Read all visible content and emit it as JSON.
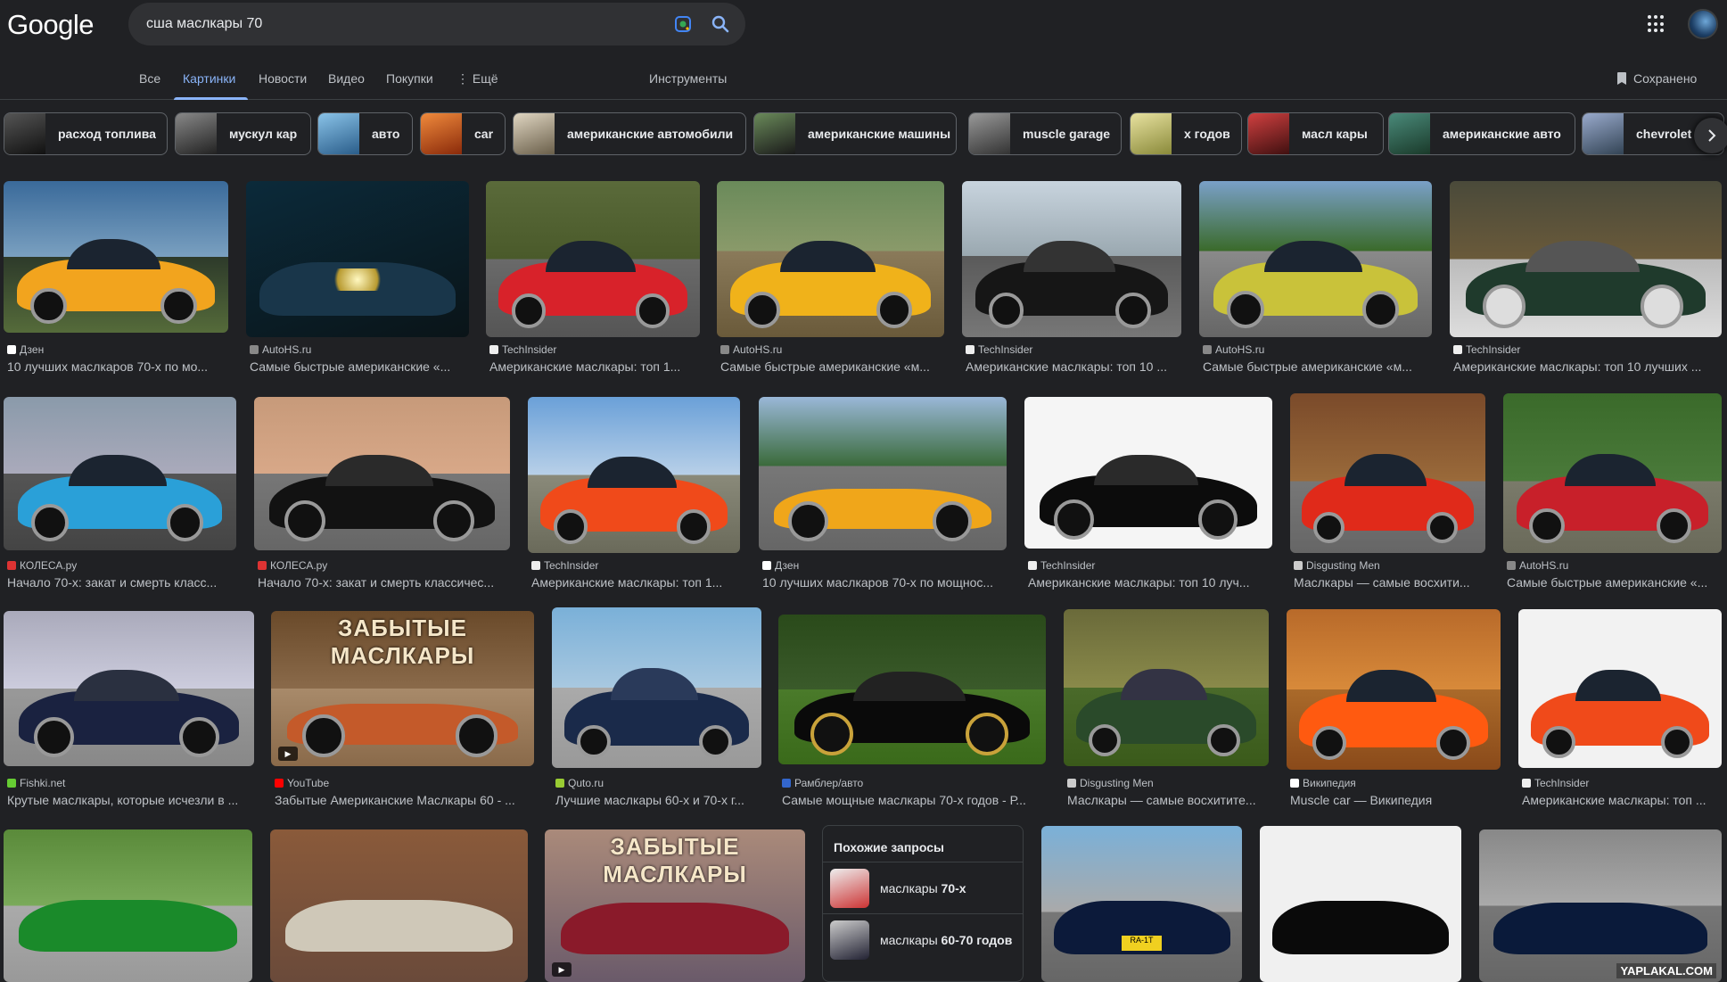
{
  "logo": "Google",
  "search": {
    "value": "сша маслкары 70"
  },
  "tabs": [
    {
      "label": "Все"
    },
    {
      "label": "Картинки"
    },
    {
      "label": "Новости"
    },
    {
      "label": "Видео"
    },
    {
      "label": "Покупки"
    },
    {
      "label": "⋮ Ещё"
    }
  ],
  "tools_label": "Инструменты",
  "saved_label": "Сохранено",
  "chips": [
    "расход топлива",
    "мускул кар",
    "авто",
    "car",
    "американские автомобили",
    "американские машины",
    "muscle garage",
    "х годов",
    "масл кары",
    "американские авто",
    "chevrolet"
  ],
  "rows": [
    [
      {
        "source": "Дзен",
        "caption": "10 лучших маслкаров 70-х по мо..."
      },
      {
        "source": "AutoHS.ru",
        "caption": "Самые быстрые американские «..."
      },
      {
        "source": "TechInsider",
        "caption": "Американские маслкары: топ 1..."
      },
      {
        "source": "AutoHS.ru",
        "caption": "Самые быстрые американские «м..."
      },
      {
        "source": "TechInsider",
        "caption": "Американские маслкары: топ 10 ..."
      },
      {
        "source": "AutoHS.ru",
        "caption": "Самые быстрые американские «м..."
      },
      {
        "source": "TechInsider",
        "caption": "Американские маслкары: топ 10 лучших ..."
      }
    ],
    [
      {
        "source": "КОЛЕСА.ру",
        "caption": "Начало 70-х: закат и смерть класс..."
      },
      {
        "source": "КОЛЕСА.ру",
        "caption": "Начало 70-х: закат и смерть классичес..."
      },
      {
        "source": "TechInsider",
        "caption": "Американские маслкары: топ 1..."
      },
      {
        "source": "Дзен",
        "caption": "10 лучших маслкаров 70-х по мощнос..."
      },
      {
        "source": "TechInsider",
        "caption": "Американские маслкары: топ 10 луч..."
      },
      {
        "source": "Disgusting Men",
        "caption": "Маслкары — самые восхити..."
      },
      {
        "source": "AutoHS.ru",
        "caption": "Самые быстрые американские «..."
      }
    ],
    [
      {
        "source": "Fishki.net",
        "caption": "Крутые маслкары, которые исчезли в ..."
      },
      {
        "source": "YouTube",
        "caption": "Забытые Американские Маслкары 60 - ..."
      },
      {
        "source": "Quto.ru",
        "caption": "Лучшие маслкары 60-х и 70-х г..."
      },
      {
        "source": "Рамблер/авто",
        "caption": "Самые мощные маслкары 70-х годов - Р..."
      },
      {
        "source": "Disgusting Men",
        "caption": "Маслкары — самые восхитите..."
      },
      {
        "source": "Википедия",
        "caption": "Muscle car — Википедия"
      },
      {
        "source": "TechInsider",
        "caption": "Американские маслкары: топ ..."
      }
    ]
  ],
  "banner_text": "ЗАБЫТЫЕ МАСЛКАРЫ",
  "watermark": "YAPLAKAL.COM",
  "plate_text": "RA-1T",
  "related": {
    "title": "Похожие запросы",
    "items": [
      {
        "prefix": "маслкары ",
        "bold": "70-х"
      },
      {
        "prefix": "маслкары ",
        "bold": "60-70 годов"
      }
    ]
  },
  "colors": {
    "background": "#202124",
    "accent": "#8ab4f8",
    "text": "#e8eaed",
    "muted": "#bdc1c6"
  }
}
